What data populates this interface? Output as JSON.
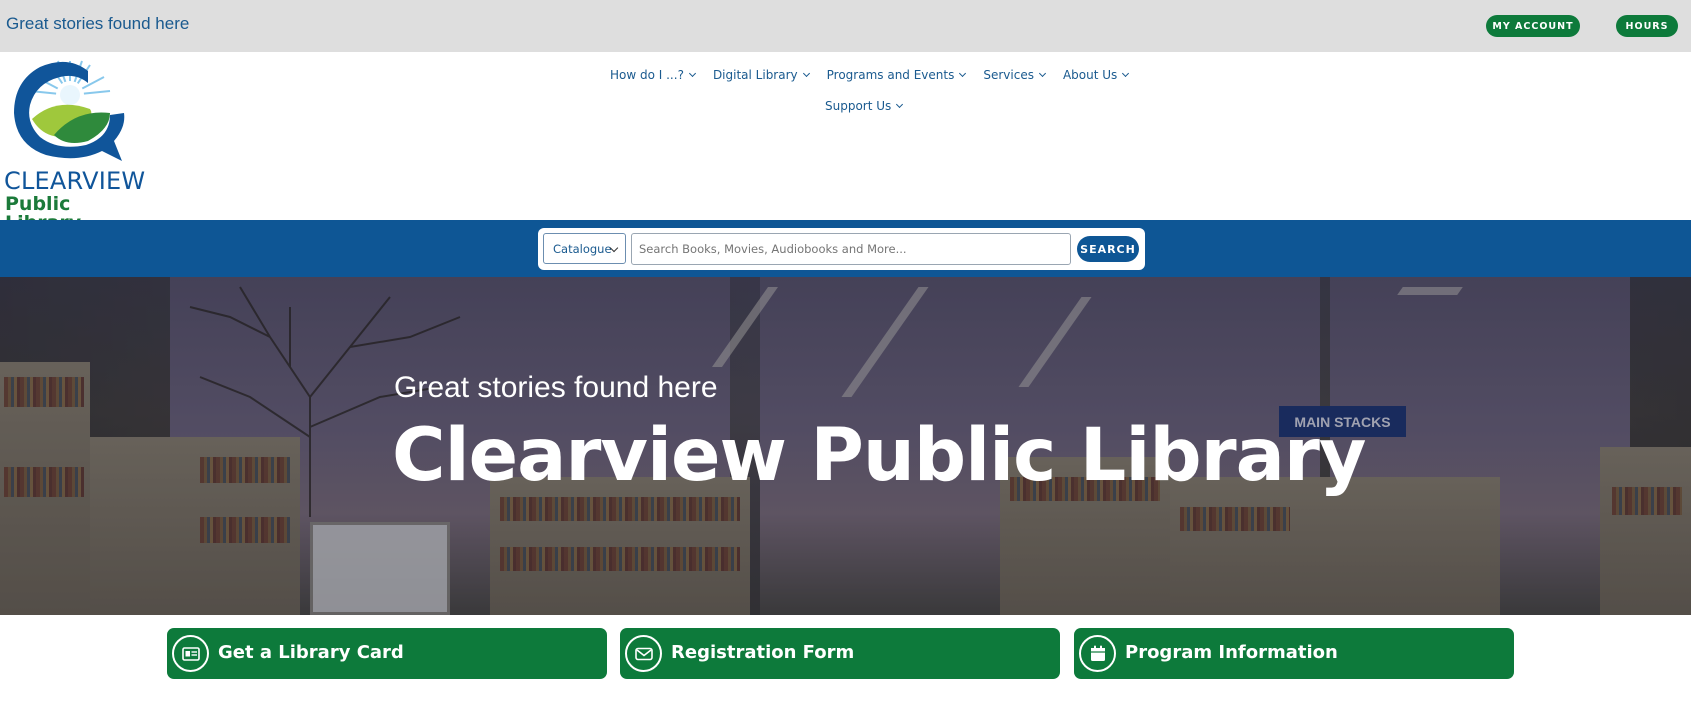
{
  "topbar": {
    "tagline": "Great stories found here",
    "my_account_label": "MY ACCOUNT",
    "hours_label": "HOURS"
  },
  "logo": {
    "line1": "CLEARVIEW",
    "line2": "Public Library"
  },
  "nav": {
    "items": [
      {
        "label": "How do I ...?"
      },
      {
        "label": "Digital Library"
      },
      {
        "label": "Programs and Events"
      },
      {
        "label": "Services"
      },
      {
        "label": "About Us"
      },
      {
        "label": "Support Us"
      }
    ]
  },
  "search": {
    "scope_selected": "Catalogue",
    "placeholder": "Search Books, Movies, Audiobooks and More...",
    "button_label": "SEARCH"
  },
  "hero": {
    "subtitle": "Great stories found here",
    "title": "Clearview Public Library",
    "sign_text": "MAIN STACKS"
  },
  "cta": [
    {
      "label": "Get a Library Card",
      "icon": "library-card-icon"
    },
    {
      "label": "Registration Form",
      "icon": "envelope-icon"
    },
    {
      "label": "Program Information",
      "icon": "calendar-icon"
    }
  ],
  "colors": {
    "brand_blue": "#0e5695",
    "brand_green": "#0d7a3b",
    "topbar_gray": "#dedede"
  }
}
